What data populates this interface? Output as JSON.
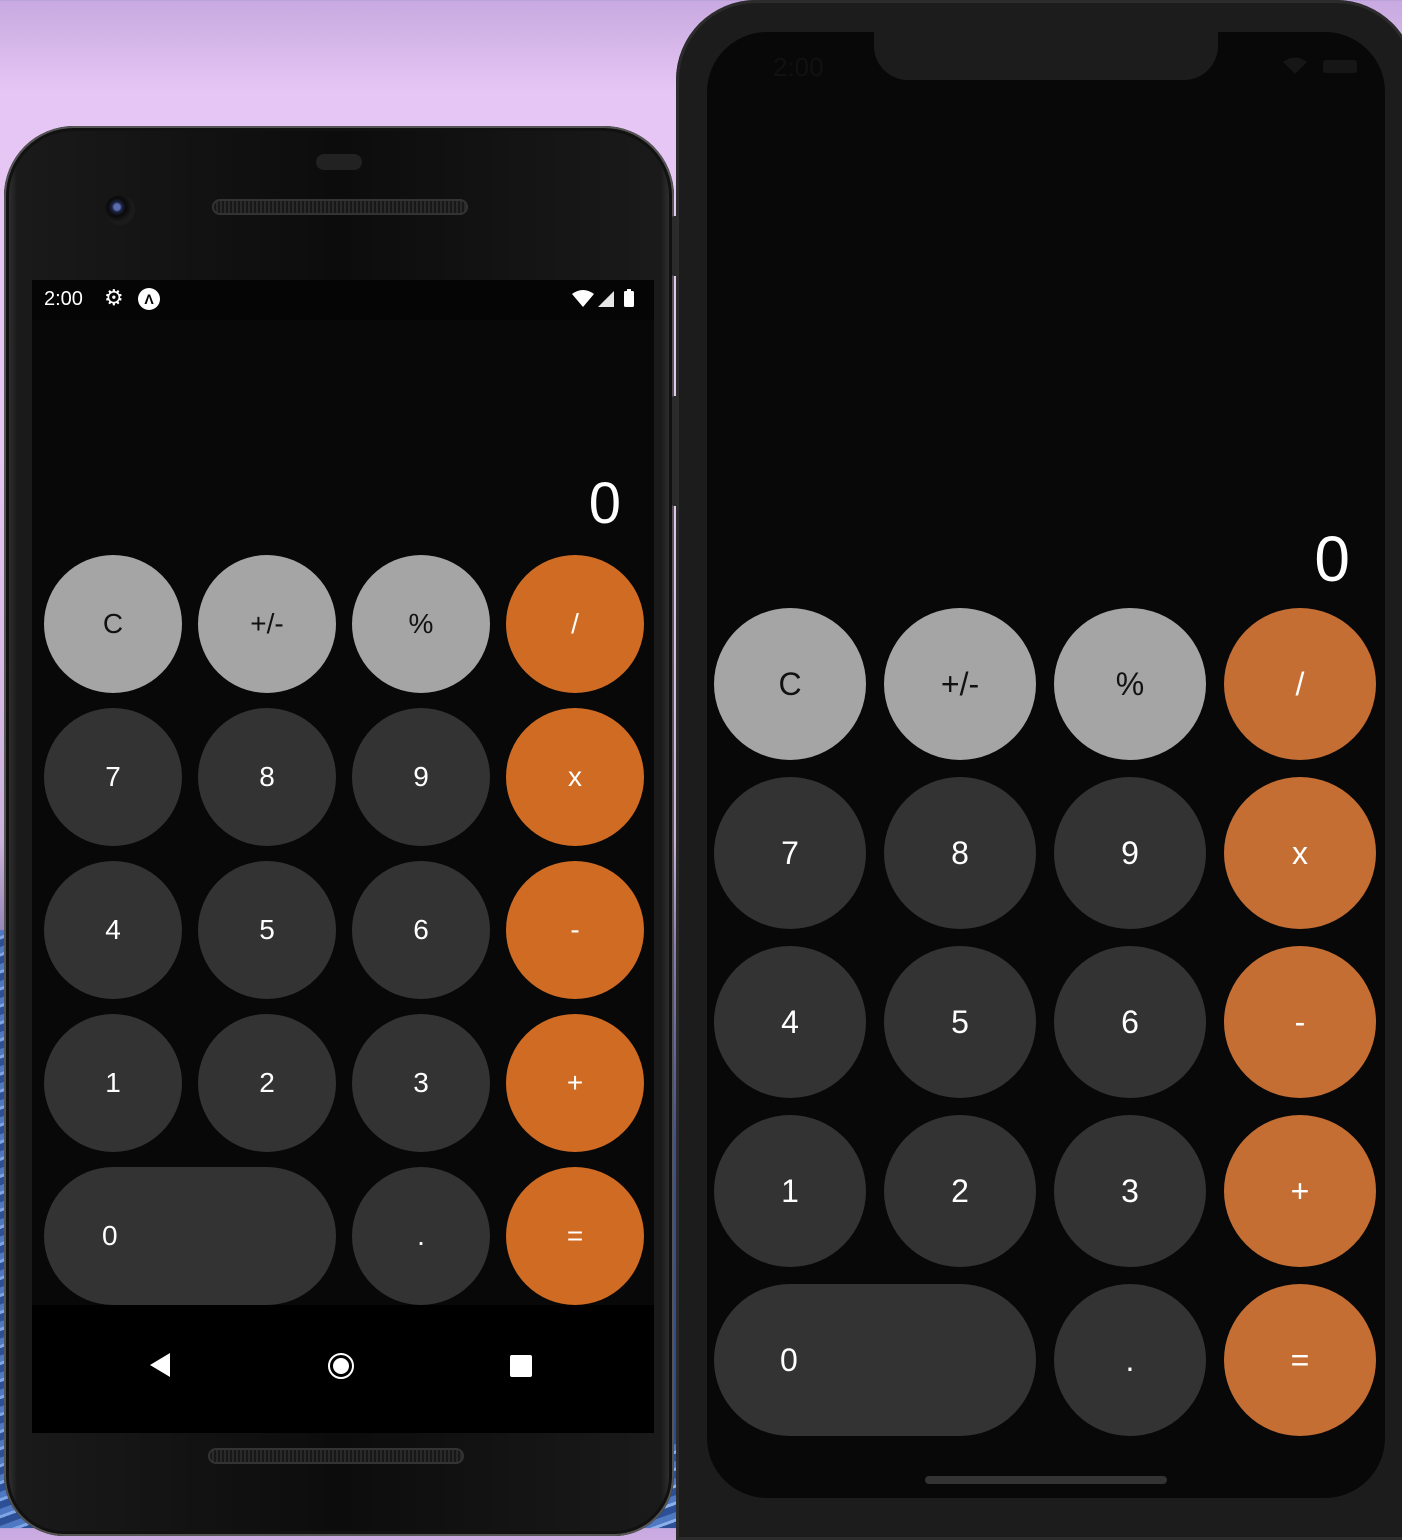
{
  "android": {
    "status_time": "2:00",
    "display_value": "0",
    "op_color": "#d06b23",
    "keys": [
      [
        "C",
        "+/-",
        "%",
        "/"
      ],
      [
        "7",
        "8",
        "9",
        "x"
      ],
      [
        "4",
        "5",
        "6",
        "-"
      ],
      [
        "1",
        "2",
        "3",
        "+"
      ],
      [
        "0",
        ".",
        "="
      ]
    ]
  },
  "iphone": {
    "status_time": "2:00",
    "display_value": "0",
    "op_color": "#c56e33",
    "keys": [
      [
        "C",
        "+/-",
        "%",
        "/"
      ],
      [
        "7",
        "8",
        "9",
        "x"
      ],
      [
        "4",
        "5",
        "6",
        "-"
      ],
      [
        "1",
        "2",
        "3",
        "+"
      ],
      [
        "0",
        ".",
        "="
      ]
    ]
  },
  "icons": {
    "android_status": [
      "gear-icon",
      "app-logo-icon",
      "wifi-icon",
      "signal-icon",
      "battery-icon"
    ],
    "android_nav": [
      "back-icon",
      "home-icon",
      "recents-icon"
    ],
    "iphone_status": [
      "wifi-icon",
      "battery-icon"
    ]
  }
}
